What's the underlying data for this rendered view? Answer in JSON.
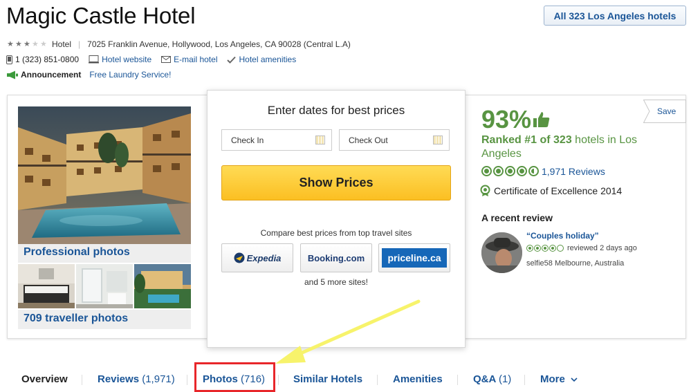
{
  "hotel": {
    "name": "Magic Castle Hotel",
    "type_label": "Hotel",
    "address": "7025 Franklin Avenue, Hollywood, Los Angeles, CA 90028 (Central L.A)",
    "star_rating": 3,
    "phone": "1 (323) 851-0800",
    "website_label": "Hotel website",
    "email_label": "E-mail hotel",
    "amenities_label": "Hotel amenities",
    "announcement_label": "Announcement",
    "announcement_text": "Free Laundry Service!"
  },
  "header": {
    "all_hotels_button": "All 323 Los Angeles hotels"
  },
  "photos": {
    "professional_label": "Professional photos",
    "traveller_label": "709 traveller photos"
  },
  "pricing": {
    "heading": "Enter dates for best prices",
    "check_in_placeholder": "Check In",
    "check_out_placeholder": "Check Out",
    "show_prices_button": "Show Prices",
    "compare_text": "Compare best prices from top travel sites",
    "vendors": [
      "Expedia",
      "Booking.com",
      "priceline.ca"
    ],
    "more_sites": "and 5 more sites!"
  },
  "rating": {
    "percent": "93%",
    "ranked_prefix": "Ranked #1 of 323",
    "ranked_suffix": " hotels in Los Angeles",
    "bubbles": 4.5,
    "reviews_count": "1,971 Reviews",
    "certificate": "Certificate of Excellence 2014",
    "recent_review_label": "A recent review",
    "recent_review_title": "“Couples holiday”",
    "recent_review_date": "reviewed 2 days ago",
    "recent_reviewer": "selfie58 Melbourne, Australia"
  },
  "save": {
    "label": "Save"
  },
  "nav": {
    "overview": "Overview",
    "reviews": "Reviews",
    "reviews_count": "(1,971)",
    "photos": "Photos",
    "photos_count": "(716)",
    "similar": "Similar Hotels",
    "amenities": "Amenities",
    "qa": "Q&A",
    "qa_count": "(1)",
    "more": "More"
  },
  "colors": {
    "link": "#1a5597",
    "rating_green": "#589442",
    "button_yellow": "#fbbf22",
    "highlight_red": "#e8262a",
    "arrow_yellow": "#f7f36b"
  }
}
